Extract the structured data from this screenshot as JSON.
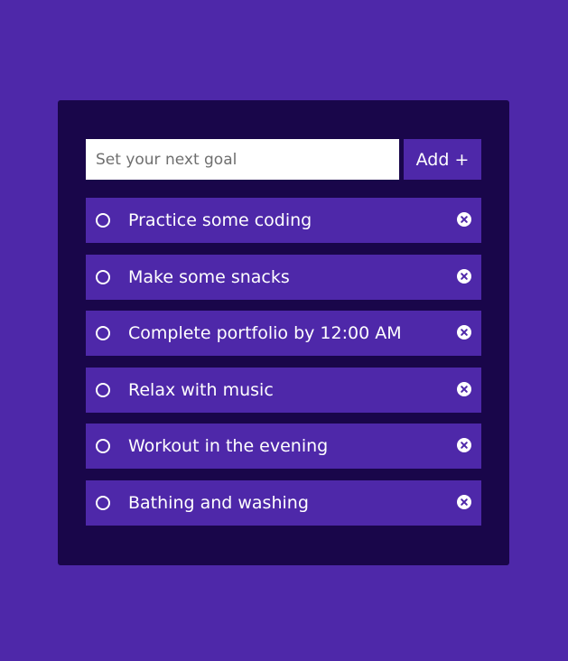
{
  "colors": {
    "background": "#4e28a9",
    "card": "#19064a",
    "item": "#4e28a9",
    "text": "#ffffff"
  },
  "input": {
    "placeholder": "Set your next goal",
    "value": ""
  },
  "add_button": {
    "label": "Add +"
  },
  "todos": [
    {
      "text": "Practice some coding",
      "icon": "circle-icon",
      "delete_icon": "close-circle-icon"
    },
    {
      "text": "Make some snacks",
      "icon": "circle-icon",
      "delete_icon": "close-circle-icon"
    },
    {
      "text": "Complete portfolio by 12:00 AM",
      "icon": "circle-icon",
      "delete_icon": "close-circle-icon"
    },
    {
      "text": "Relax with music",
      "icon": "circle-icon",
      "delete_icon": "close-circle-icon"
    },
    {
      "text": "Workout in the evening",
      "icon": "circle-icon",
      "delete_icon": "close-circle-icon"
    },
    {
      "text": "Bathing and washing",
      "icon": "circle-icon",
      "delete_icon": "close-circle-icon"
    }
  ]
}
